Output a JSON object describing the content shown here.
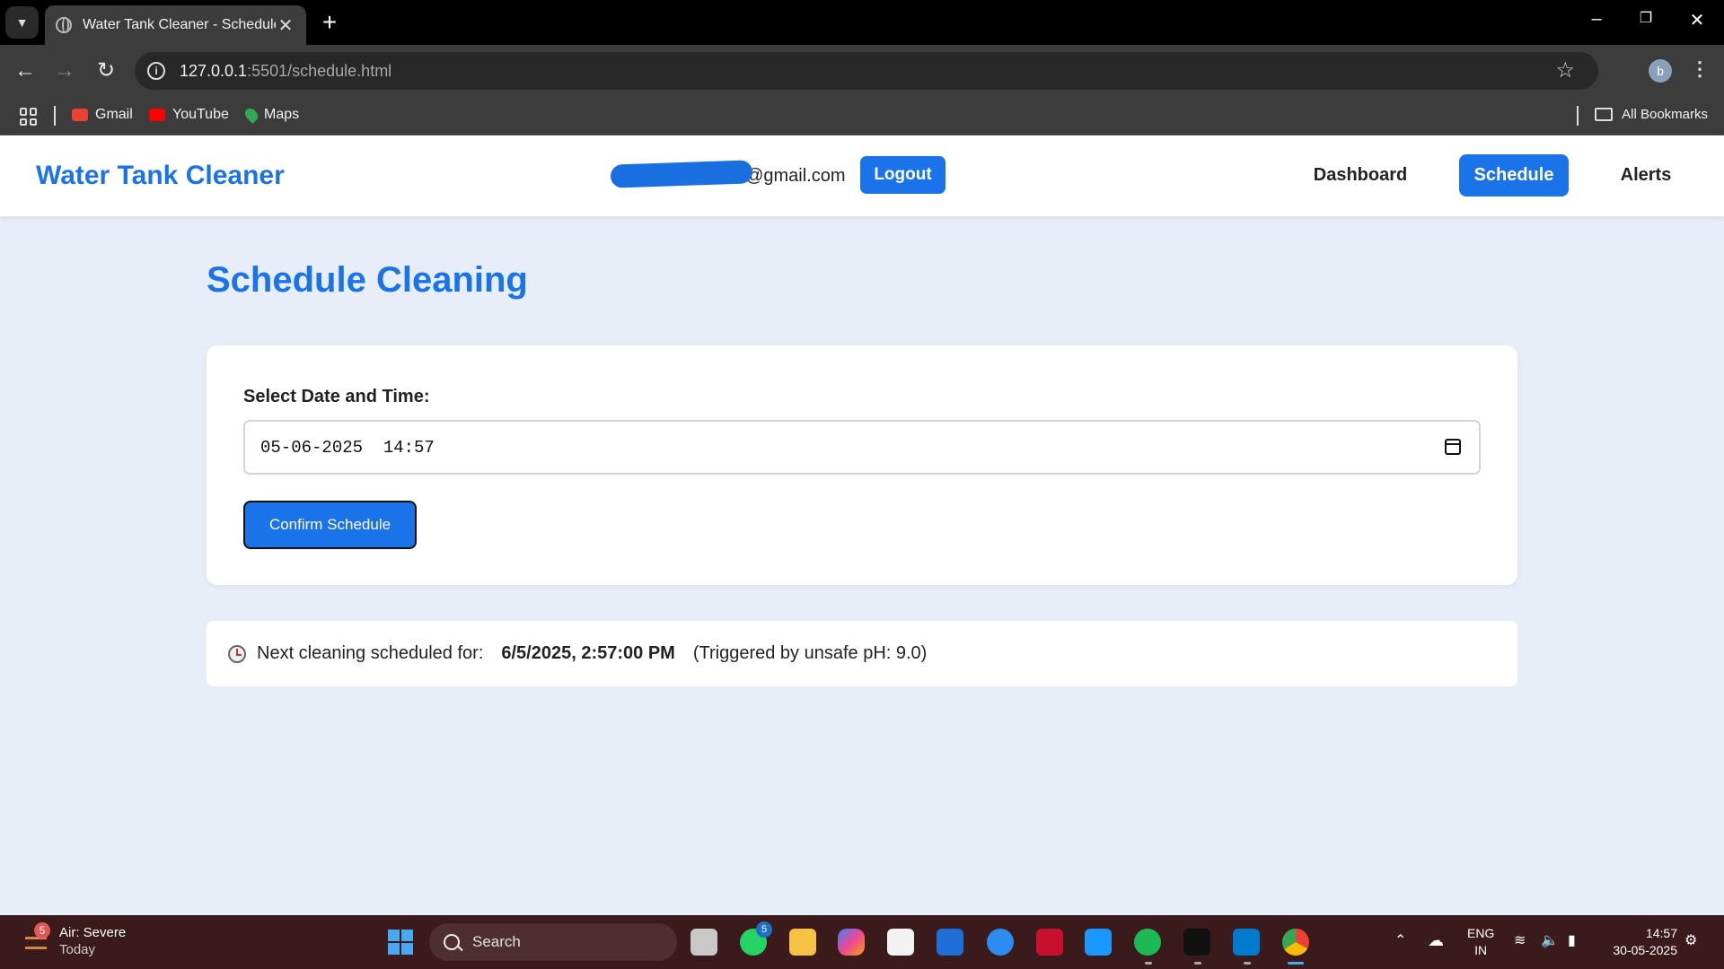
{
  "browser": {
    "tab_title": "Water Tank Cleaner - Schedule",
    "url_host": "127.0.0.1",
    "url_path": ":5501/schedule.html",
    "profile_initial": "b",
    "bookmarks": [
      {
        "label": "Gmail"
      },
      {
        "label": "YouTube"
      },
      {
        "label": "Maps"
      }
    ],
    "all_bookmarks": "All Bookmarks"
  },
  "header": {
    "brand": "Water Tank Cleaner",
    "user_email": "@gmail.com",
    "logout_label": "Logout",
    "nav": [
      {
        "label": "Dashboard",
        "active": false
      },
      {
        "label": "Schedule",
        "active": true
      },
      {
        "label": "Alerts",
        "active": false
      }
    ]
  },
  "main": {
    "title": "Schedule Cleaning",
    "form": {
      "label": "Select Date and Time:",
      "datetime_value": "05-06-2025  14:57",
      "confirm_label": "Confirm Schedule"
    },
    "info": {
      "prefix": "Next cleaning scheduled for:",
      "date": "6/5/2025, 2:57:00 PM",
      "reason": "(Triggered by unsafe pH: 9.0)"
    }
  },
  "taskbar": {
    "weather_title": "Air: Severe",
    "weather_sub": "Today",
    "weather_badge": "5",
    "search_placeholder": "Search",
    "whatsapp_badge": "5",
    "lang_top": "ENG",
    "lang_bottom": "IN",
    "time": "14:57",
    "date": "30-05-2025"
  },
  "colors": {
    "accent": "#1a73e8",
    "page_bg": "#e8eef8",
    "taskbar_bg": "#3b1a1c"
  }
}
